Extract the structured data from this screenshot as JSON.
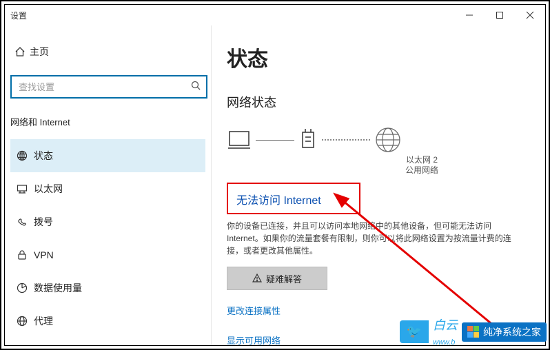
{
  "window": {
    "title": "设置"
  },
  "sidebar": {
    "home": "主页",
    "search_placeholder": "查找设置",
    "section": "网络和 Internet",
    "items": [
      {
        "label": "状态"
      },
      {
        "label": "以太网"
      },
      {
        "label": "拨号"
      },
      {
        "label": "VPN"
      },
      {
        "label": "数据使用量"
      },
      {
        "label": "代理"
      }
    ]
  },
  "main": {
    "title": "状态",
    "subtitle": "网络状态",
    "conn_name": "以太网 2",
    "conn_type": "公用网络",
    "alert": "无法访问 Internet",
    "body": "你的设备已连接，并且可以访问本地网络中的其他设备，但可能无法访问 Internet。如果你的流量套餐有限制，则你可以将此网络设置为按流量计费的连接，或者更改其他属性。",
    "troubleshoot": "疑难解答",
    "link1": "更改连接属性",
    "link2": "显示可用网络"
  },
  "watermark": {
    "by1": "白云",
    "by2": "www.b",
    "brand": "纯净系统之家"
  }
}
